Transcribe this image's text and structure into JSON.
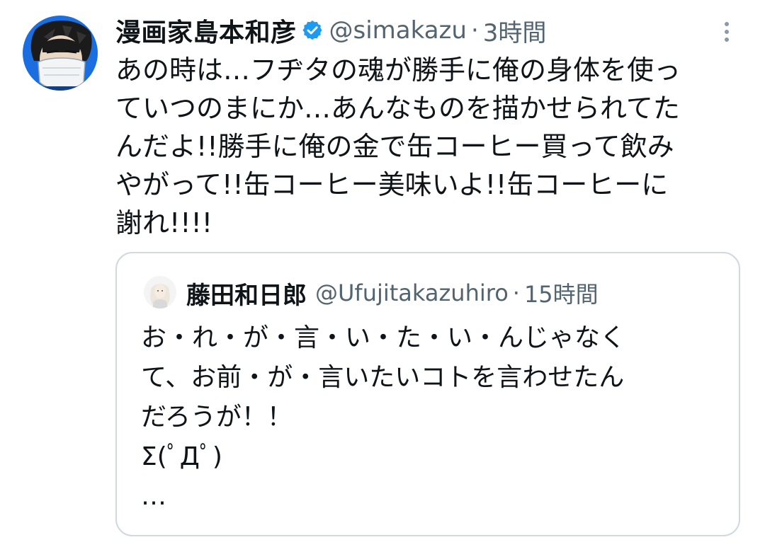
{
  "tweet": {
    "display_name": "漫画家島本和彦",
    "handle": "@simakazu",
    "separator": "·",
    "time": "3時間",
    "verified_color": "#1d9bf0",
    "body": "あの時は…フヂタの魂が勝手に俺の身体を使っ\nていつのまにか…あんなものを描かせられてた\nんだよ!!勝手に俺の金で缶コーヒー買って飲み\nやがって!!缶コーヒー美味いよ!!缶コーヒーに\n謝れ!!!!"
  },
  "quote": {
    "display_name": "藤田和日郎",
    "handle": "@Ufujitakazuhiro",
    "separator": "·",
    "time": "15時間",
    "body": "お・れ・が・言・い・た・い・んじゃなく\nて、お前・が・言いたいコトを言わせたん\nだろうが！！\nΣ(ﾟДﾟ)\n…"
  },
  "icons": {
    "more": "more-vertical-icon",
    "verified": "verified-badge-icon"
  }
}
